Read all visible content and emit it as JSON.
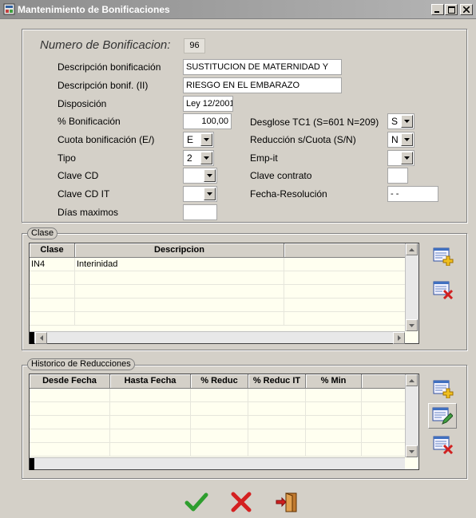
{
  "window": {
    "title": "Mantenimiento de Bonificaciones"
  },
  "form": {
    "numero_label": "Numero de Bonificacion:",
    "numero_value": "96",
    "descripcion_label": "Descripción  bonificación",
    "descripcion_value": "SUSTITUCION DE MATERNIDAD Y",
    "descripcion2_label": "Descripción bonif. (II)",
    "descripcion2_value": "RIESGO EN EL EMBARAZO",
    "disposicion_label": "Disposición",
    "disposicion_value": "Ley 12/2001",
    "pct_label": "% Bonificación",
    "pct_value": "100,00",
    "cuota_label": "Cuota bonificación (E/)",
    "cuota_value": "E",
    "tipo_label": "Tipo",
    "tipo_value": "2",
    "clave_cd_label": "Clave CD",
    "clave_cd_value": "",
    "clave_cd_it_label": "Clave CD IT",
    "clave_cd_it_value": "",
    "dias_label": "Días maximos",
    "dias_value": "",
    "desglose_label": "Desglose  TC1 (S=601 N=209)",
    "desglose_value": "S",
    "reduccion_label": "Reducción s/Cuota (S/N)",
    "reduccion_value": "N",
    "empit_label": "Emp-it",
    "empit_value": "",
    "clave_contrato_label": "Clave contrato",
    "clave_contrato_value": "",
    "fecha_label": "Fecha-Resolución",
    "fecha_value": "- -"
  },
  "clase": {
    "caption": "Clase",
    "columns": [
      "Clase",
      "Descripcion",
      ""
    ],
    "rows": [
      [
        "IN4",
        "Interinidad",
        ""
      ]
    ]
  },
  "historico": {
    "caption": "Historico de Reducciones",
    "columns": [
      "Desde Fecha",
      "Hasta Fecha",
      "% Reduc",
      "% Reduc IT",
      "% Min",
      ""
    ]
  },
  "icons": {
    "add": "add-record-icon",
    "delete": "delete-record-icon",
    "edit": "edit-record-icon",
    "accept": "check-icon",
    "cancel": "cancel-x-icon",
    "exit": "exit-door-icon"
  },
  "colors": {
    "grid_bg": "#fffff0",
    "window_bg": "#d4d0c8",
    "accept": "#2e9e2e",
    "cancel": "#d42020"
  }
}
